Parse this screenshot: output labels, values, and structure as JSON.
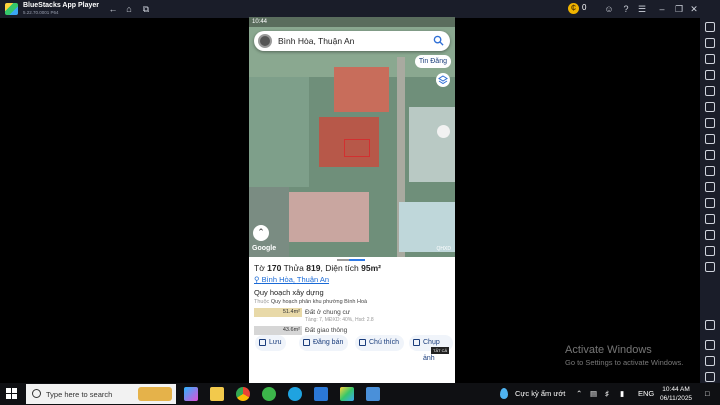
{
  "window": {
    "title": "BlueStacks App Player",
    "version": "5.22.70.0001 P64",
    "coin_count": "0"
  },
  "phone": {
    "time": "10:44",
    "search": {
      "text": "Bình Hòa, Thuận An"
    },
    "tin_dang": "Tin Đăng",
    "map": {
      "google_label": "Google",
      "qhxd_label": "QHXD"
    },
    "parcel": {
      "to_label": "Tờ",
      "to_value": "170",
      "thua_label": "Thửa",
      "thua_value": "819",
      "dt_label": ", Diện tích",
      "dt_value": "95m²",
      "address_ward": "Bình Hòa",
      "address_district": "Thuận An",
      "planning_title": "Quy hoạch xây dựng",
      "belongs_prefix": "Thuộc",
      "belongs_text": "Quy hoạch phân khu phường Bình Hoà",
      "zones": [
        {
          "area": "51.4m²",
          "label": "Đất ở chung cư",
          "sub": "Tầng: 7, MĐXD: 40%, Hsd: 2.8",
          "color": "#e8d9a8"
        },
        {
          "area": "43.6m²",
          "label": "Đất giao thông",
          "sub": "",
          "color": "#d6d6d6"
        }
      ]
    },
    "actions": [
      {
        "label": "Lưu"
      },
      {
        "label": "Đăng bán"
      },
      {
        "label": "Chú thích"
      },
      {
        "label": "Chụp ảnh"
      }
    ],
    "tat_ca": "TẤT CẢ"
  },
  "activation": {
    "line1": "Activate Windows",
    "line2": "Go to Settings to activate Windows."
  },
  "taskbar": {
    "search_placeholder": "Type here to search",
    "weather": "Cực kỳ ẩm ướt",
    "language": "ENG",
    "time": "10:44 AM",
    "date": "06/11/2025"
  }
}
